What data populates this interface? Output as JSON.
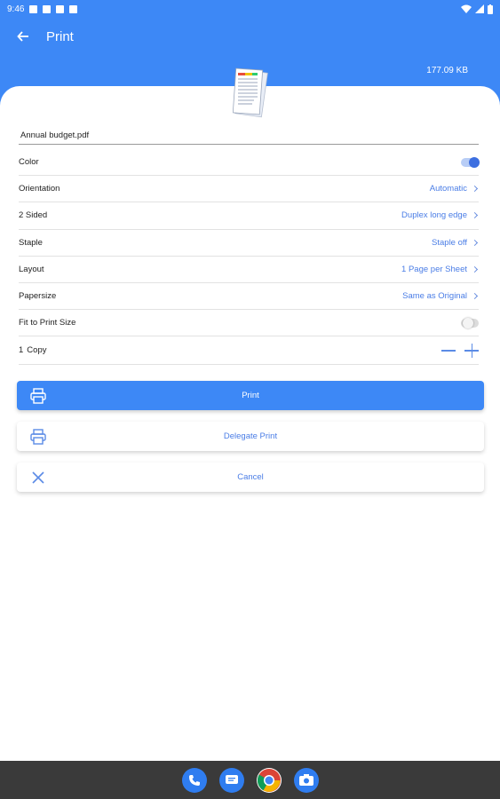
{
  "status_bar": {
    "time": "9:46"
  },
  "app_bar": {
    "title": "Print",
    "back_icon": "arrow-left-icon"
  },
  "document": {
    "file_size": "177.09 KB",
    "file_name": "Annual budget.pdf"
  },
  "settings": {
    "color": {
      "label": "Color",
      "enabled": true
    },
    "orientation": {
      "label": "Orientation",
      "value": "Automatic"
    },
    "two_sided": {
      "label": "2 Sided",
      "value": "Duplex long edge"
    },
    "staple": {
      "label": "Staple",
      "value": "Staple off"
    },
    "layout": {
      "label": "Layout",
      "value": "1 Page per Sheet"
    },
    "papersize": {
      "label": "Papersize",
      "value": "Same as Original"
    },
    "fit_to_print": {
      "label": "Fit to Print Size",
      "enabled": false
    },
    "copies": {
      "count": "1",
      "label": "Copy"
    }
  },
  "actions": {
    "print": "Print",
    "delegate": "Delegate Print",
    "cancel": "Cancel"
  },
  "dock": [
    "phone-icon",
    "messages-icon",
    "chrome-icon",
    "camera-icon"
  ],
  "colors": {
    "primary": "#3d88f6",
    "accent_text": "#4a7de6",
    "nav_bar": "#3a3a3a"
  }
}
